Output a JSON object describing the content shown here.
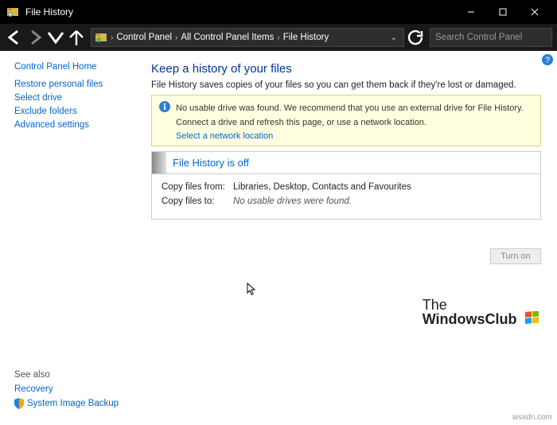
{
  "window": {
    "title": "File History",
    "min": "—",
    "max": "☐",
    "close": "✕"
  },
  "breadcrumb": {
    "items": [
      "Control Panel",
      "All Control Panel Items",
      "File History"
    ]
  },
  "search": {
    "placeholder": "Search Control Panel"
  },
  "sidebar": {
    "heading": "Control Panel Home",
    "links": [
      "Restore personal files",
      "Select drive",
      "Exclude folders",
      "Advanced settings"
    ],
    "see_also": "See also",
    "recovery": "Recovery",
    "sib": "System Image Backup"
  },
  "main": {
    "title": "Keep a history of your files",
    "desc": "File History saves copies of your files so you can get them back if they're lost or damaged.",
    "alert_msg": "No usable drive was found. We recommend that you use an external drive for File History. Connect a drive and refresh this page, or use a network location.",
    "net_link": "Select a network location",
    "status_title": "File History is off",
    "copy_from_lbl": "Copy files from:",
    "copy_from_val": "Libraries, Desktop, Contacts and Favourites",
    "copy_to_lbl": "Copy files to:",
    "copy_to_val": "No usable drives were found.",
    "turn_on": "Turn on"
  },
  "watermark": {
    "line1": "The",
    "line2": "WindowsClub"
  },
  "srcref": "wsxdn.com"
}
